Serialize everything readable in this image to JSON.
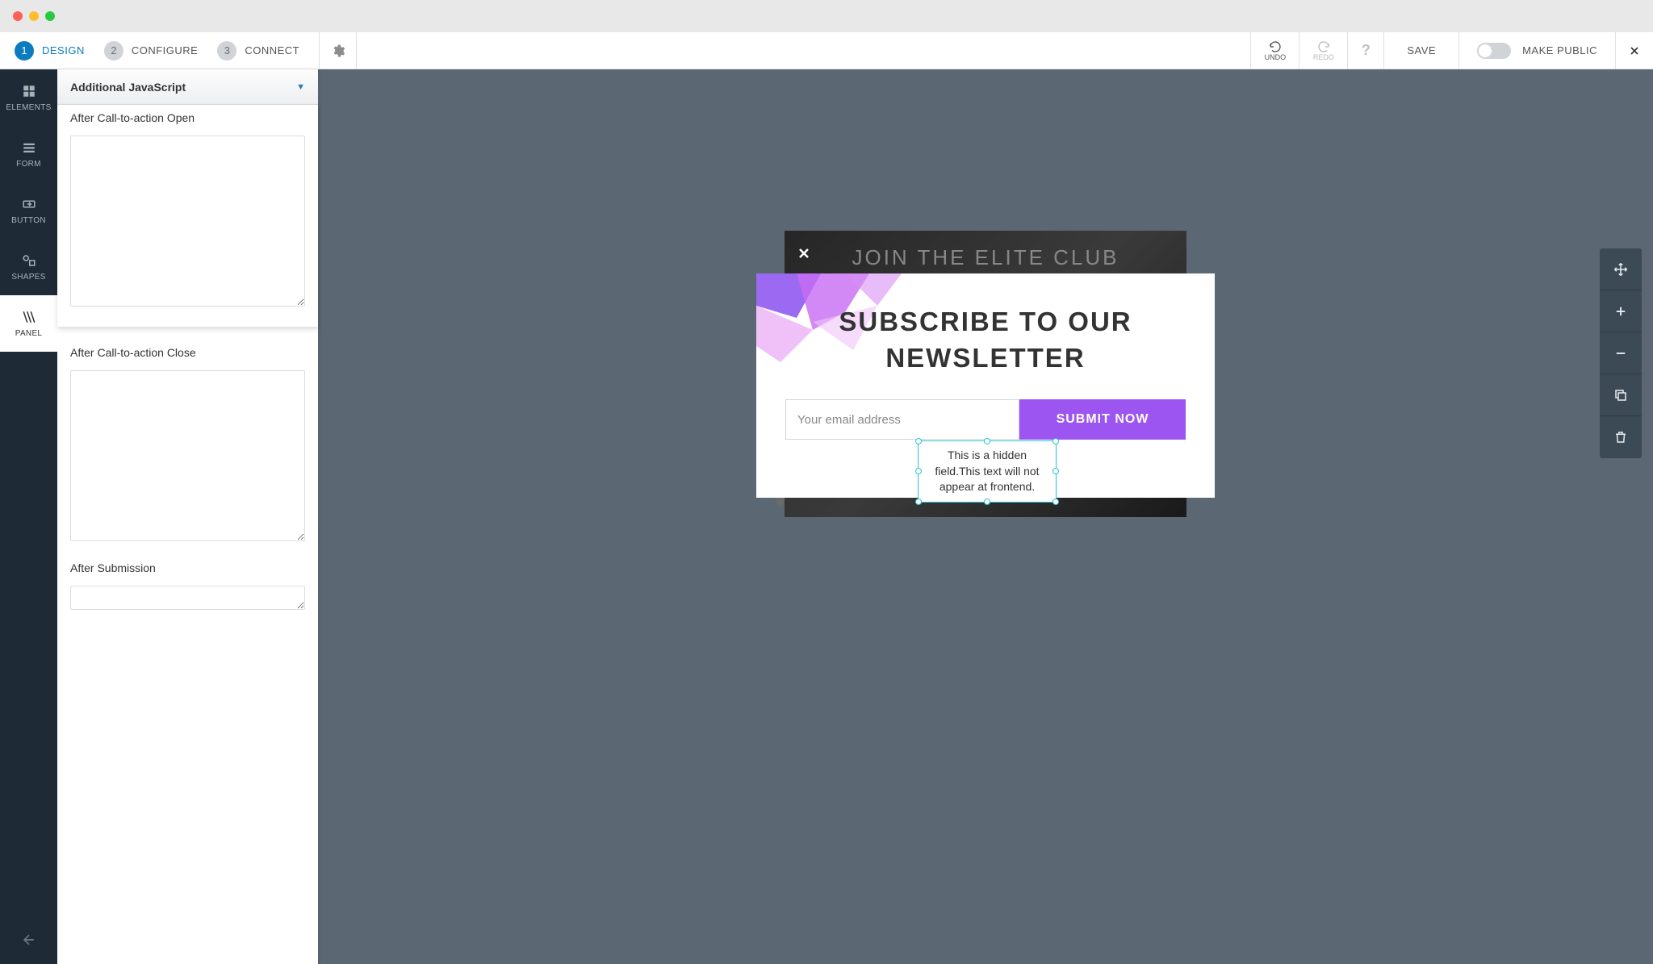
{
  "steps": [
    {
      "num": "1",
      "label": "DESIGN",
      "active": true
    },
    {
      "num": "2",
      "label": "CONFIGURE",
      "active": false
    },
    {
      "num": "3",
      "label": "CONNECT",
      "active": false
    }
  ],
  "toolbar": {
    "undo": "UNDO",
    "redo": "REDO",
    "save": "SAVE",
    "make_public": "MAKE PUBLIC"
  },
  "leftnav": {
    "elements": "ELEMENTS",
    "form": "FORM",
    "button": "BUTTON",
    "shapes": "SHAPES",
    "panel": "PANEL"
  },
  "panel": {
    "header": "Additional JavaScript",
    "after_open_label": "After Call-to-action Open",
    "after_close_label": "After Call-to-action Close",
    "after_submission_label": "After Submission"
  },
  "preview": {
    "back_title": "JOIN THE ELITE CLUB",
    "front_title": "SUBSCRIBE TO OUR NEWSLETTER",
    "email_placeholder": "Your email address",
    "submit_label": "SUBMIT NOW",
    "hidden_text": "This is a hidden field.This text will not appear at frontend."
  }
}
